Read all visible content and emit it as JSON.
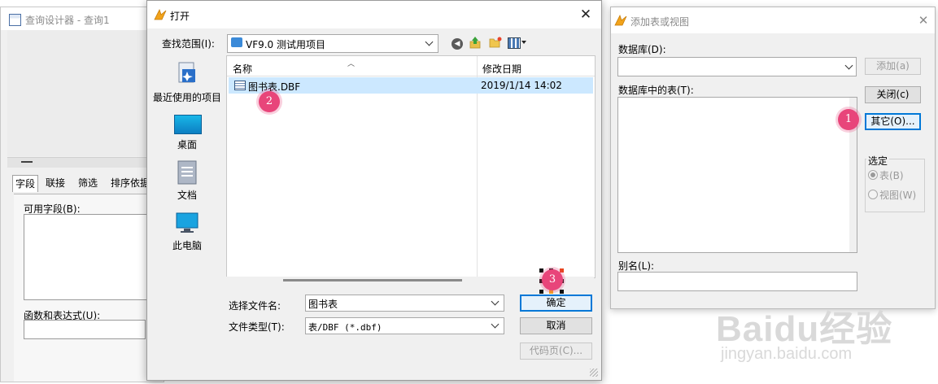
{
  "query_designer": {
    "title": "查询设计器 - 查询1",
    "tabs": [
      "字段",
      "联接",
      "筛选",
      "排序依据"
    ],
    "available_fields_label": "可用字段(B):",
    "functions_label": "函数和表达式(U):"
  },
  "open_dialog": {
    "title": "打开",
    "look_in_label": "查找范围(I):",
    "look_in_value": "VF9.0 测试用项目",
    "places": [
      {
        "label": "最近使用的项目",
        "icon": "recent-items-icon"
      },
      {
        "label": "桌面",
        "icon": "desktop-icon"
      },
      {
        "label": "文档",
        "icon": "documents-icon"
      },
      {
        "label": "此电脑",
        "icon": "this-pc-icon"
      }
    ],
    "columns": {
      "name": "名称",
      "date": "修改日期"
    },
    "files": [
      {
        "name": "图书表.DBF",
        "date": "2019/1/14 14:02",
        "selected": true
      }
    ],
    "filename_label": "选择文件名:",
    "filename_value": "图书表",
    "filetype_label": "文件类型(T):",
    "filetype_value": "表/DBF (*.dbf)",
    "ok_label": "确定",
    "cancel_label": "取消",
    "codepage_label": "代码页(C)..."
  },
  "add_dialog": {
    "title": "添加表或视图",
    "database_label": "数据库(D):",
    "add_label": "添加(a)",
    "tables_label": "数据库中的表(T):",
    "close_label": "关闭(c)",
    "other_label": "其它(O)...",
    "select_group_label": "选定",
    "radio_table": "表(B)",
    "radio_view": "视图(W)",
    "alias_label": "别名(L):"
  },
  "markers": [
    "1",
    "2",
    "3"
  ],
  "watermark": {
    "main": "Baidu经验",
    "url": "jingyan.baidu.com"
  },
  "colors": {
    "selection": "#cce8ff",
    "default_button_border": "#0078d7",
    "marker": "#e8457a"
  }
}
